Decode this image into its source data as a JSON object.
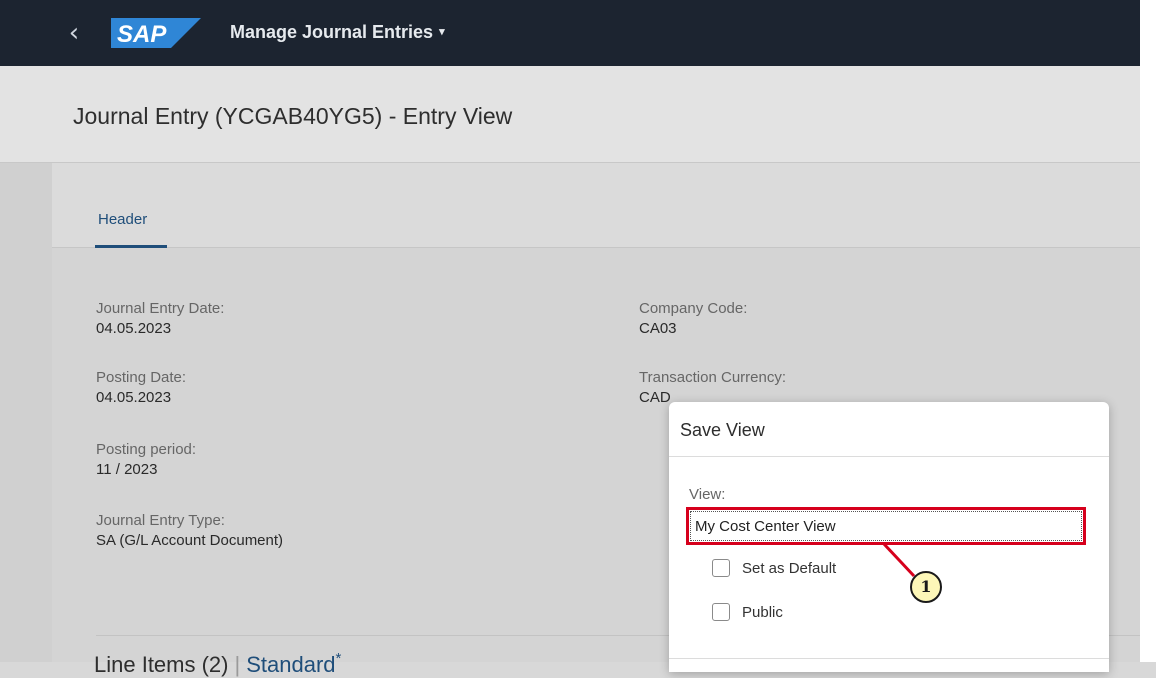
{
  "shell": {
    "back_icon": "chevron-left-icon",
    "logo_text": "SAP",
    "app_title": "Manage Journal Entries",
    "app_title_caret": "▾",
    "bar_color": "#1c2430"
  },
  "page": {
    "title": "Journal Entry (YCGAB40YG5) - Entry View"
  },
  "tabs": [
    {
      "label": "Header",
      "selected": true
    }
  ],
  "fields": {
    "journal_entry_date": {
      "label": "Journal Entry Date:",
      "value": "04.05.2023"
    },
    "posting_date": {
      "label": "Posting Date:",
      "value": "04.05.2023"
    },
    "posting_period": {
      "label": "Posting period:",
      "value": "11 / 2023"
    },
    "journal_entry_type": {
      "label": "Journal Entry Type:",
      "value": "SA (G/L Account Document)"
    },
    "company_code": {
      "label": "Company Code:",
      "value": "CA03"
    },
    "transaction_currency": {
      "label": "Transaction Currency:",
      "value": "CAD"
    }
  },
  "line_items": {
    "title": "Line Items (2)",
    "separator": "|",
    "variant": "Standard",
    "modified_marker": "*"
  },
  "dialog": {
    "title": "Save View",
    "view_label": "View:",
    "view_value": "My Cost Center View",
    "set_default_label": "Set as Default",
    "public_label": "Public",
    "set_default_checked": false,
    "public_checked": false
  },
  "annotation": {
    "callout_number": "1",
    "highlight_color": "#d6001c",
    "callout_fill": "#fdf7b8"
  }
}
